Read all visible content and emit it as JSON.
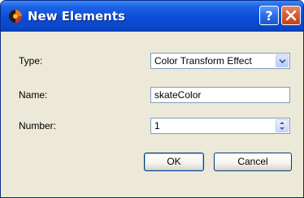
{
  "window": {
    "title": "New Elements"
  },
  "form": {
    "type_label": "Type:",
    "type_value": "Color Transform Effect",
    "name_label": "Name:",
    "name_value": "skateColor",
    "number_label": "Number:",
    "number_value": "1"
  },
  "buttons": {
    "ok_label": "OK",
    "cancel_label": "Cancel"
  },
  "icons": {
    "app": "app-icon",
    "help": "help-icon",
    "close": "close-icon",
    "dropdown": "chevron-down-icon",
    "spin_up": "spin-up-icon",
    "spin_down": "spin-down-icon"
  },
  "colors": {
    "titlebar": "#0a4dd8",
    "close_button": "#d45a34",
    "dialog_bg": "#ece9d8",
    "field_border": "#7f9db9"
  }
}
